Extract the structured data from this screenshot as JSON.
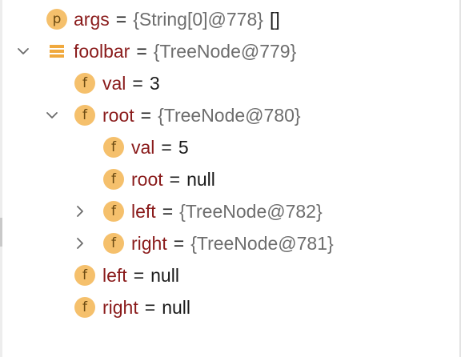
{
  "variables_tree": {
    "rows": [
      {
        "kind_icon": "param-icon",
        "icon_letter": "p",
        "name": "args",
        "equals": "=",
        "value": "{String[0]@778}",
        "extra": "[]",
        "toggle": "none"
      },
      {
        "kind_icon": "stack-icon",
        "icon_letter": "",
        "name": "foolbar",
        "equals": "=",
        "value": "{TreeNode@779}",
        "toggle": "expanded"
      },
      {
        "kind_icon": "field-icon",
        "icon_letter": "f",
        "name": "val",
        "equals": "=",
        "value": "3",
        "toggle": "none"
      },
      {
        "kind_icon": "field-icon",
        "icon_letter": "f",
        "name": "root",
        "equals": "=",
        "value": "{TreeNode@780}",
        "toggle": "expanded"
      },
      {
        "kind_icon": "field-icon",
        "icon_letter": "f",
        "name": "val",
        "equals": "=",
        "value": "5",
        "toggle": "none"
      },
      {
        "kind_icon": "field-icon",
        "icon_letter": "f",
        "name": "root",
        "equals": "=",
        "value": "null",
        "toggle": "none"
      },
      {
        "kind_icon": "field-icon",
        "icon_letter": "f",
        "name": "left",
        "equals": "=",
        "value": "{TreeNode@782}",
        "toggle": "collapsed"
      },
      {
        "kind_icon": "field-icon",
        "icon_letter": "f",
        "name": "right",
        "equals": "=",
        "value": "{TreeNode@781}",
        "toggle": "collapsed"
      },
      {
        "kind_icon": "field-icon",
        "icon_letter": "f",
        "name": "left",
        "equals": "=",
        "value": "null",
        "toggle": "none"
      },
      {
        "kind_icon": "field-icon",
        "icon_letter": "f",
        "name": "right",
        "equals": "=",
        "value": "null",
        "toggle": "none"
      }
    ]
  },
  "colors": {
    "name": "#8a1b1b",
    "object_value": "#6e6e6e",
    "plain_value": "#1a1a1a",
    "icon_fill": "#f5c06c",
    "icon_letter": "#6b4a12",
    "stack_icon": "#f0a93e"
  }
}
